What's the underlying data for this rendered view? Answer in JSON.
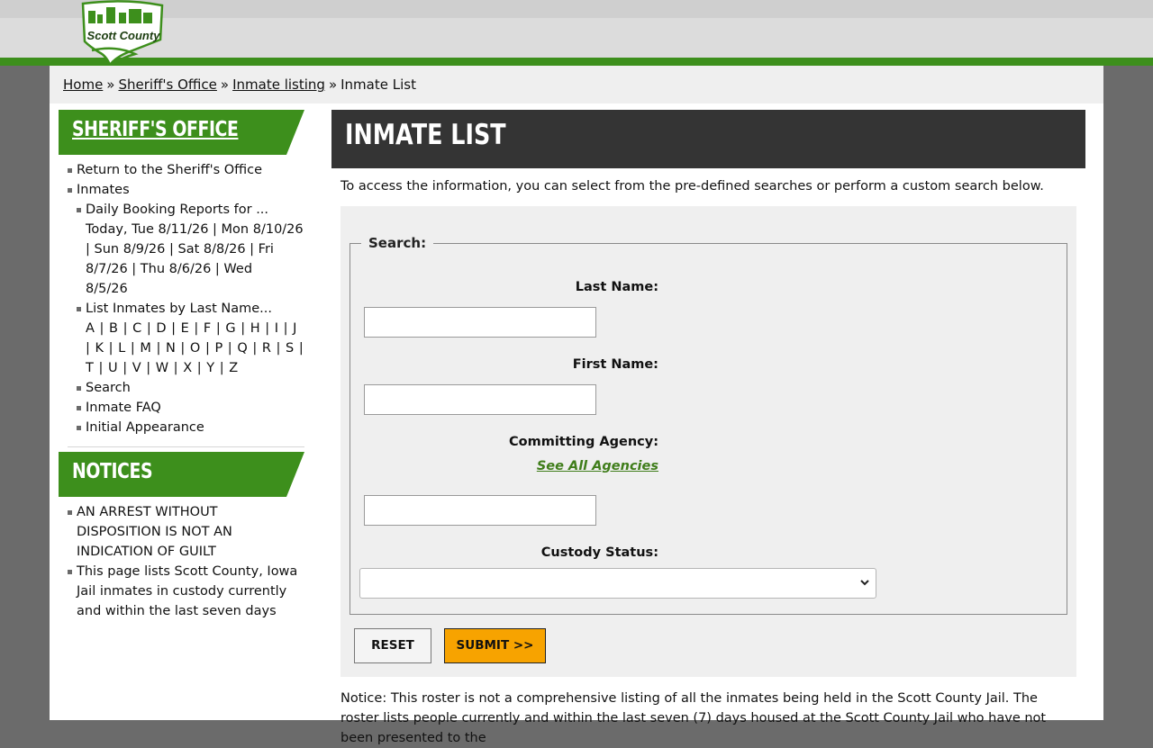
{
  "header": {
    "logo_text": "Scott County"
  },
  "breadcrumb": {
    "home": "Home",
    "sep": "»",
    "sheriff": "Sheriff's Office",
    "listing": "Inmate listing",
    "current": "Inmate List"
  },
  "sidebar": {
    "office_title": "SHERIFF'S OFFICE",
    "return": "Return to the Sheriff's Office",
    "inmates": "Inmates",
    "daily_reports": "Daily Booking Reports for ...",
    "days": [
      "Today, Tue 8/11/26",
      "Mon 8/10/26",
      "Sun 8/9/26",
      "Sat 8/8/26",
      "Fri 8/7/26",
      "Thu 8/6/26",
      "Wed 8/5/26"
    ],
    "by_last_name": "List Inmates by Last Name...",
    "letters": [
      "A",
      "B",
      "C",
      "D",
      "E",
      "F",
      "G",
      "H",
      "I",
      "J",
      "K",
      "L",
      "M",
      "N",
      "O",
      "P",
      "Q",
      "R",
      "S",
      "T",
      "U",
      "V",
      "W",
      "X",
      "Y",
      "Z"
    ],
    "search": "Search",
    "faq": "Inmate FAQ",
    "initial": "Initial Appearance",
    "notices_title": "NOTICES",
    "notices": [
      "AN ARREST WITHOUT DISPOSITION IS NOT AN INDICATION OF GUILT",
      "This page lists Scott County, Iowa Jail inmates in custody currently and within the last seven days"
    ]
  },
  "main": {
    "title": "INMATE LIST",
    "intro": "To access the information, you can select from the pre-defined searches or perform a custom search below.",
    "legend": "Search:",
    "last_name_label": "Last Name:",
    "last_name_value": "",
    "first_name_label": "First Name:",
    "first_name_value": "",
    "agency_label": "Committing Agency:",
    "see_all_agencies": "See All Agencies",
    "agency_value": "",
    "custody_label": "Custody Status:",
    "custody_value": "",
    "reset": "RESET",
    "submit": "SUBMIT >>",
    "notice": "Notice: This roster is not a comprehensive listing of all the inmates being held in the Scott County Jail. The roster lists people currently and within the last seven (7) days housed at the Scott County Jail who have not been presented to the"
  },
  "colors": {
    "brand_green": "#3d8f1c",
    "header_dark": "#343434",
    "submit_orange": "#f7a300"
  }
}
